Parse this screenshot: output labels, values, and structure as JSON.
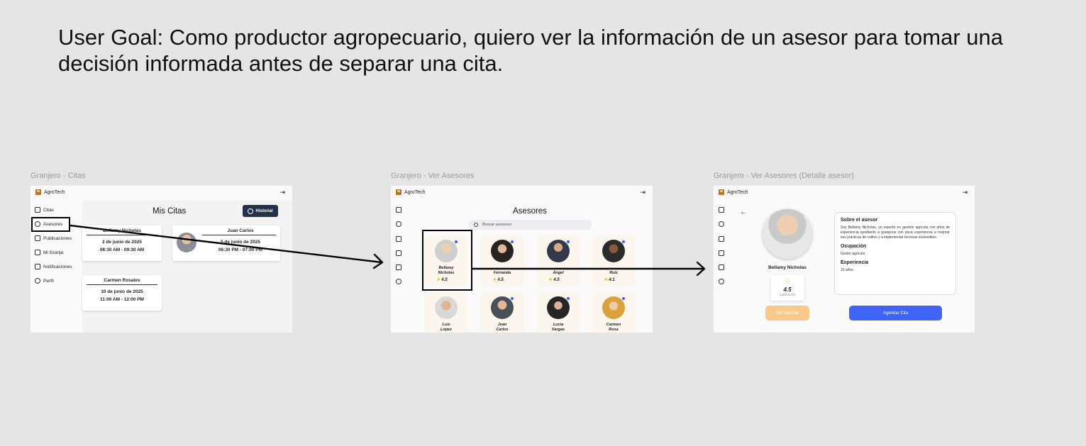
{
  "goal": "User Goal: Como productor agropecuario, quiero ver la información de un asesor para tomar una decisión informada antes de separar una cita.",
  "frames": {
    "citas": {
      "label": "Granjero - Citas"
    },
    "asesores": {
      "label": "Granjero - Ver Asesores"
    },
    "detalle": {
      "label": "Granjero - Ver Asesores (Detalle asesor)"
    }
  },
  "app": {
    "name": "AgroTech",
    "logout_icon": "logout-icon"
  },
  "sidebar": {
    "items": [
      {
        "label": "Citas",
        "icon": "calendar-icon"
      },
      {
        "label": "Asesores",
        "icon": "users-icon"
      },
      {
        "label": "Publicaciones",
        "icon": "publications-icon"
      },
      {
        "label": "Mi Granja",
        "icon": "home-icon"
      },
      {
        "label": "Notificaciones",
        "icon": "bell-icon"
      },
      {
        "label": "Perfil",
        "icon": "profile-icon"
      }
    ]
  },
  "citas": {
    "title": "Mis Citas",
    "history_button": "Historial",
    "appointments": [
      {
        "name": "Bellamy Nicholas",
        "date": "2 de junio de 2025",
        "time": "08:30 AM - 09:30 AM"
      },
      {
        "name": "Juan Carlos",
        "date": "5 de junio de 2025",
        "time": "06:30 PM - 07:00 PM"
      },
      {
        "name": "Carmen Rosales",
        "date": "10 de junio de 2025",
        "time": "11:00 AM - 12:00 PM"
      }
    ]
  },
  "asesores": {
    "title": "Asesores",
    "search_placeholder": "Buscar asesores",
    "advisors": [
      {
        "name": "Bellamy\nNicholas",
        "rating": "4.5"
      },
      {
        "name": "Fernanda",
        "rating": "4.5"
      },
      {
        "name": "Ángel",
        "rating": "4.5"
      },
      {
        "name": "Ruiz",
        "rating": "4.1"
      },
      {
        "name": "Luis\nLopez",
        "rating": ""
      },
      {
        "name": "Juan\nCarlos",
        "rating": ""
      },
      {
        "name": "Lucia\nVargas",
        "rating": ""
      },
      {
        "name": "Carmen\nRosa",
        "rating": ""
      }
    ]
  },
  "detalle": {
    "back_icon": "back-arrow-icon",
    "name": "Bellamy Nicholas",
    "rating": "4.5",
    "rating_label": "Calificación",
    "about_title": "Sobre el asesor",
    "about_text": "Soy Bellamy Nicholas, un experto en gestión agrícola con años de experiencia ayudando a granjeros con poca experiencia a mejorar sus prácticas de cultivo y a implementar técnicas sostenibles.",
    "occupation_title": "Ocupación",
    "occupation": "Gestor agrícola",
    "experience_title": "Experiencia",
    "experience": "10 años",
    "reviews_button": "Ver reseñas",
    "schedule_button": "Agendar Cita"
  },
  "colors": {
    "background": "#e5e5e5",
    "dark_button": "#23324a",
    "primary_blue": "#3e63f5",
    "reviews_yellow": "#f8c98a",
    "online_dot": "#3b5bfd",
    "star": "#f1c40f"
  }
}
